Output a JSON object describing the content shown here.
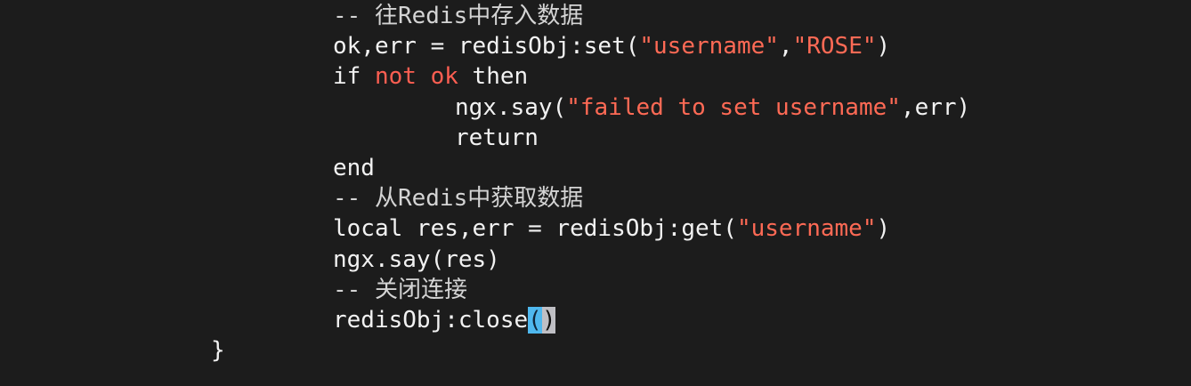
{
  "editor": {
    "colors": {
      "background": "#1c1c1c",
      "text": "#f2f2f2",
      "keyword": "#ff5f52",
      "string": "#ff6a55",
      "selection": "#4fb8ee"
    },
    "lines": [
      {
        "indent": 1,
        "tokens": [
          {
            "type": "comment",
            "text": "-- 往Redis中存入数据"
          }
        ]
      },
      {
        "indent": 1,
        "tokens": [
          {
            "type": "plain",
            "text": "ok,err = redisObj:set("
          },
          {
            "type": "str",
            "text": "\"username\""
          },
          {
            "type": "plain",
            "text": ","
          },
          {
            "type": "str",
            "text": "\"ROSE\""
          },
          {
            "type": "plain",
            "text": ")"
          }
        ]
      },
      {
        "indent": 1,
        "tokens": [
          {
            "type": "plain",
            "text": "if "
          },
          {
            "type": "kw",
            "text": "not ok"
          },
          {
            "type": "plain",
            "text": " then"
          }
        ]
      },
      {
        "indent": 2,
        "tokens": [
          {
            "type": "plain",
            "text": "ngx.say("
          },
          {
            "type": "str",
            "text": "\"failed to set username\""
          },
          {
            "type": "plain",
            "text": ",err)"
          }
        ]
      },
      {
        "indent": 2,
        "tokens": [
          {
            "type": "plain",
            "text": "return"
          }
        ]
      },
      {
        "indent": 1,
        "tokens": [
          {
            "type": "plain",
            "text": "end"
          }
        ]
      },
      {
        "indent": 1,
        "tokens": [
          {
            "type": "comment",
            "text": "-- 从Redis中获取数据"
          }
        ]
      },
      {
        "indent": 1,
        "tokens": [
          {
            "type": "plain",
            "text": "local res,err = redisObj:get("
          },
          {
            "type": "str",
            "text": "\"username\""
          },
          {
            "type": "plain",
            "text": ")"
          }
        ]
      },
      {
        "indent": 1,
        "tokens": [
          {
            "type": "plain",
            "text": "ngx.say(res)"
          }
        ]
      },
      {
        "indent": 1,
        "tokens": [
          {
            "type": "comment",
            "text": "-- 关闭连接"
          }
        ]
      },
      {
        "indent": 1,
        "tokens": [
          {
            "type": "plain",
            "text": "redisObj:close"
          },
          {
            "type": "sel1",
            "text": "("
          },
          {
            "type": "sel2",
            "text": ")"
          }
        ]
      },
      {
        "indent": 0,
        "tokens": [
          {
            "type": "plain",
            "text": "}"
          }
        ]
      }
    ]
  }
}
